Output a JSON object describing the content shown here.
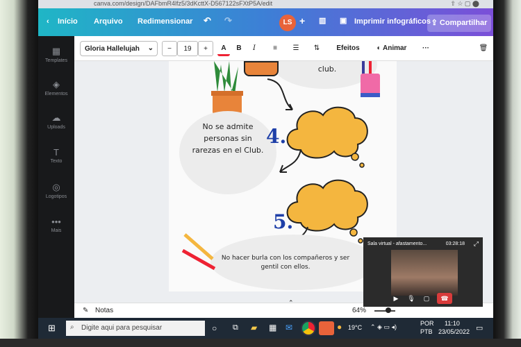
{
  "browser": {
    "url": "canva.com/design/DAFbmR4lfz5/3dKcttX-D567122sFXtP5A/edit"
  },
  "header": {
    "home": "Início",
    "file": "Arquivo",
    "resize": "Redimensionar",
    "avatar": "LS",
    "print": "Imprimir infográficos",
    "share": "Compartilhar"
  },
  "rail": [
    {
      "label": "Templates",
      "icon": "templates-icon"
    },
    {
      "label": "Elementos",
      "icon": "elements-icon"
    },
    {
      "label": "Uploads",
      "icon": "upload-icon"
    },
    {
      "label": "Texto",
      "icon": "text-icon"
    },
    {
      "label": "Logotipos",
      "icon": "logo-icon"
    },
    {
      "label": "Mais",
      "icon": "more-icon"
    }
  ],
  "toolbar": {
    "font": "Gloria Hallelujah",
    "font_size": "19",
    "effects": "Efeitos",
    "animate": "Animar"
  },
  "canvas": {
    "top_text": "club.",
    "text4": "No se admite personas sin rarezas en el Club.",
    "num4": "4.",
    "num5": "5.",
    "text5": "No hacer burla con los compañeros y ser gentil con ellos."
  },
  "bottombar": {
    "notes": "Notas",
    "zoom": "64%"
  },
  "video": {
    "title": "Sala virtual - afastamento...",
    "time": "03:28:18"
  },
  "taskbar": {
    "search_placeholder": "Digite aqui para pesquisar",
    "weather": "19°C",
    "lang1": "POR",
    "lang2": "PTB",
    "time": "11:10",
    "date": "23/05/2022"
  },
  "colors": {
    "cloud": "#f4b63f",
    "accent_blue": "#1e3fa8",
    "avatar": "#e8633a",
    "end_call": "#d93b3b"
  }
}
